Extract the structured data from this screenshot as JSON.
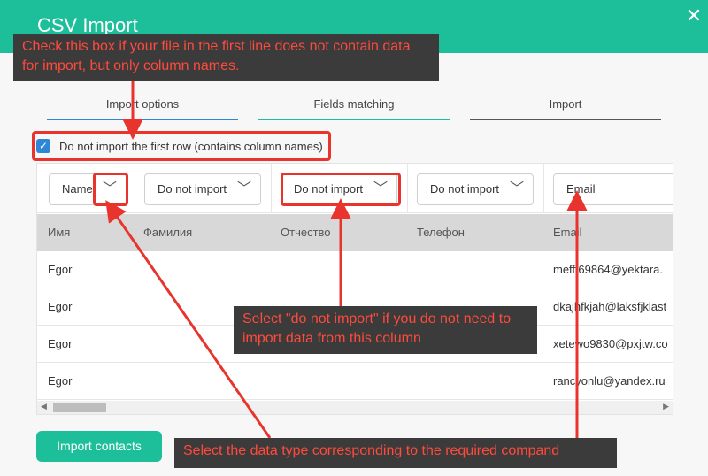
{
  "window": {
    "title": "CSV Import",
    "close_glyph": "✕"
  },
  "tabs": [
    {
      "label": "Import options"
    },
    {
      "label": "Fields matching"
    },
    {
      "label": "Import"
    }
  ],
  "options": {
    "skip_first_row_label": "Do not import the first row (contains column names)",
    "skip_first_row_checked": true
  },
  "mapping_selects": [
    {
      "value": "Name"
    },
    {
      "value": "Do not import"
    },
    {
      "value": "Do not import"
    },
    {
      "value": "Do not import"
    },
    {
      "value": "Email"
    }
  ],
  "table": {
    "columns": [
      "Имя",
      "Фамилия",
      "Отчество",
      "Телефон",
      "Email"
    ],
    "rows": [
      [
        "Egor",
        "",
        "",
        "",
        "mefff69864@yektara."
      ],
      [
        "Egor",
        "",
        "",
        "",
        "dkajhfkjah@laksfjklast"
      ],
      [
        "Egor",
        "",
        "",
        "",
        "xetewo9830@pxjtw.co"
      ],
      [
        "Egor",
        "",
        "",
        "",
        "rancyonlu@yandex.ru"
      ]
    ]
  },
  "actions": {
    "import_label": "Import contacts"
  },
  "annotations": {
    "callout_checkbox": "Check this box if your file in the first line does not contain data for import, but only column names.",
    "callout_do_not_import": "Select \"do not import\" if you do not need to import data from this column",
    "callout_data_type": "Select the data type corresponding to the required compand"
  },
  "colors": {
    "accent": "#1dbf9a",
    "blue": "#2e87d6",
    "annotation_red": "#e8342d",
    "callout_bg": "#3b3b3b"
  }
}
